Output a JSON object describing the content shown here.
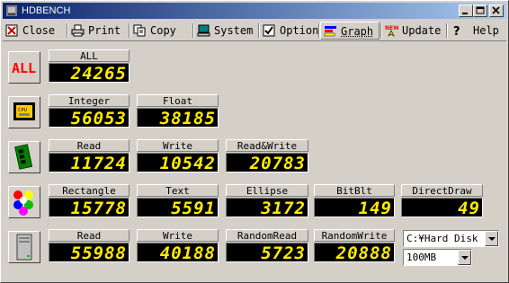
{
  "window": {
    "title": "HDBENCH"
  },
  "menu": {
    "close": "Close",
    "print": "Print",
    "copy": "Copy",
    "system": "System",
    "option": "Option",
    "graph": "Graph",
    "update": "Update",
    "help": "Help"
  },
  "all": {
    "icon_text": "ALL",
    "label": "ALL",
    "value": "24265"
  },
  "cpu": {
    "integer": {
      "label": "Integer",
      "value": "56053"
    },
    "float": {
      "label": "Float",
      "value": "38185"
    }
  },
  "memory": {
    "read": {
      "label": "Read",
      "value": "11724"
    },
    "write": {
      "label": "Write",
      "value": "10542"
    },
    "readwrite": {
      "label": "Read&Write",
      "value": "20783"
    }
  },
  "video": {
    "rectangle": {
      "label": "Rectangle",
      "value": "15778"
    },
    "text": {
      "label": "Text",
      "value": "5591"
    },
    "ellipse": {
      "label": "Ellipse",
      "value": "3172"
    },
    "bitblt": {
      "label": "BitBlt",
      "value": "149"
    },
    "directdraw": {
      "label": "DirectDraw",
      "value": "49"
    }
  },
  "drive": {
    "read": {
      "label": "Read",
      "value": "55988"
    },
    "write": {
      "label": "Write",
      "value": "40188"
    },
    "randomread": {
      "label": "RandomRead",
      "value": "5723"
    },
    "randomwrite": {
      "label": "RandomWrite",
      "value": "20888"
    },
    "drive_select": "C:¥Hard Disk",
    "size_select": "100MB"
  },
  "icons": [
    "app-icon",
    "close-icon",
    "print-icon",
    "copy-icon",
    "system-icon",
    "option-checkbox-icon",
    "graph-icon",
    "update-icon",
    "help-icon",
    "cpu-icon",
    "memory-icon",
    "video-icon",
    "drive-icon"
  ],
  "colors": {
    "lcd_text": "#ffec00",
    "lcd_bg": "#000000",
    "titlebar": "#0a246a",
    "face": "#d4d0c8"
  }
}
